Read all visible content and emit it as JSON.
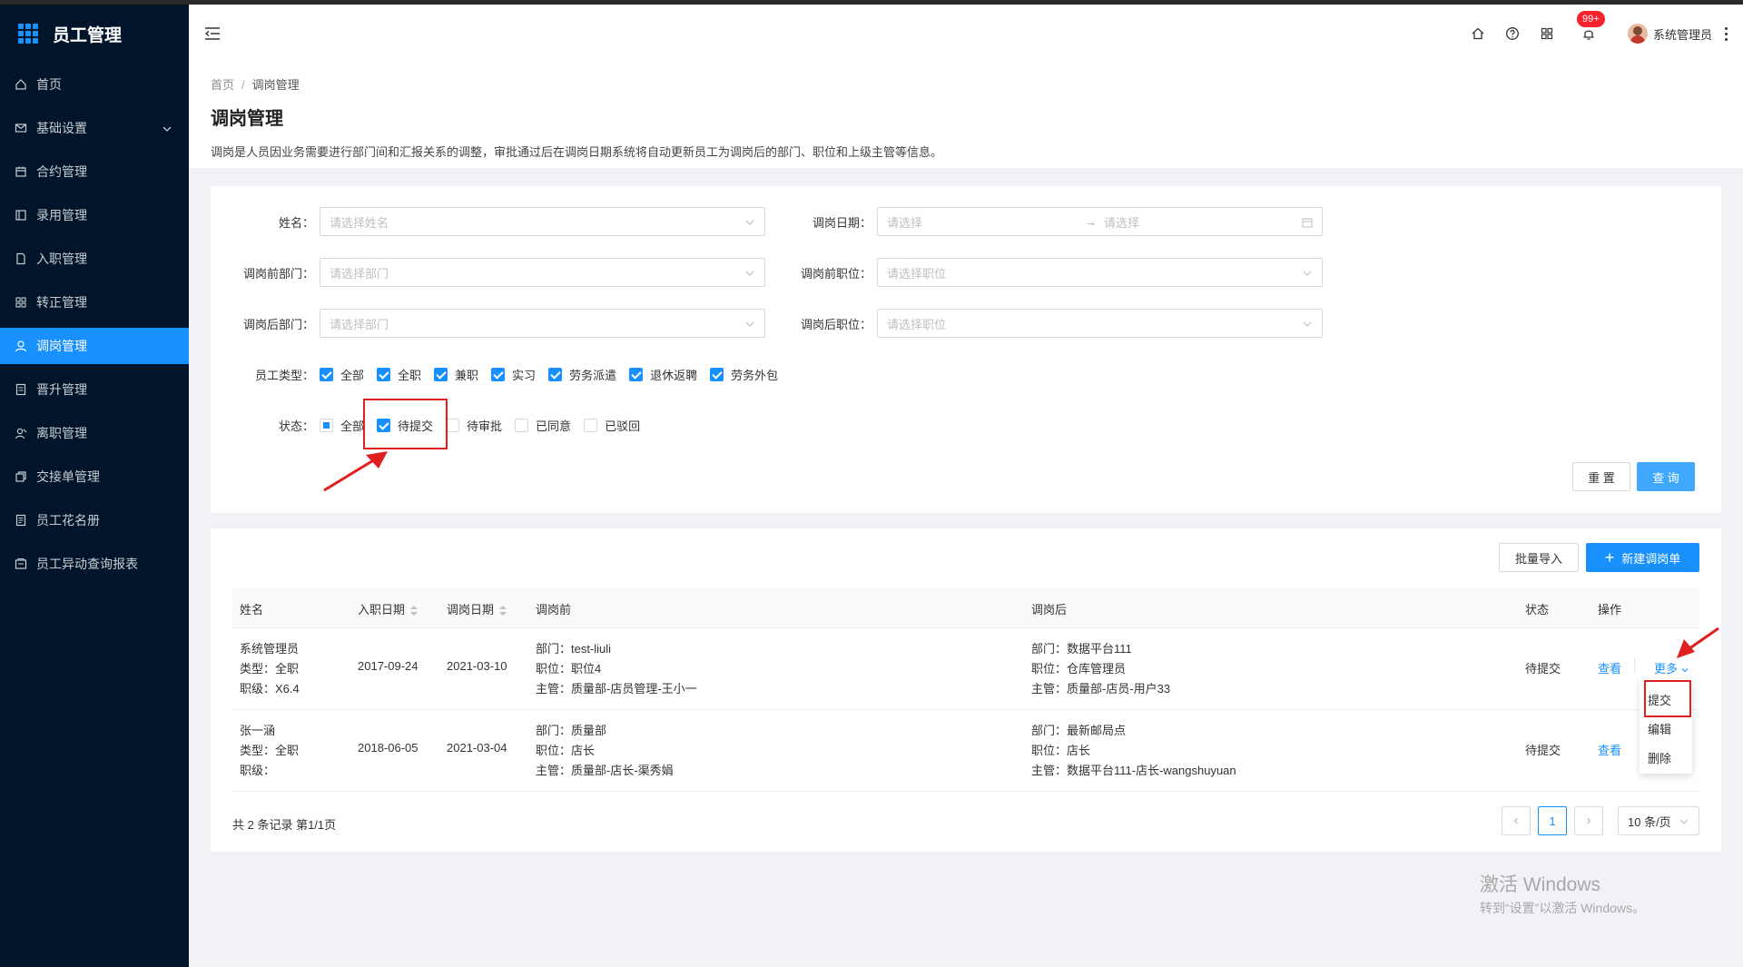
{
  "app": {
    "title": "员工管理"
  },
  "colors": {
    "primary": "#1890ff",
    "sidebar_bg": "#001529",
    "highlight": "#e02020"
  },
  "sidebar": {
    "items": [
      {
        "label": "首页",
        "icon": "home-icon"
      },
      {
        "label": "基础设置",
        "icon": "mail-icon"
      },
      {
        "label": "合约管理",
        "icon": "calendar-icon"
      },
      {
        "label": "录用管理",
        "icon": "book-icon"
      },
      {
        "label": "入职管理",
        "icon": "file-icon"
      },
      {
        "label": "转正管理",
        "icon": "table-icon"
      },
      {
        "label": "调岗管理",
        "icon": "user-icon"
      },
      {
        "label": "晋升管理",
        "icon": "doc-icon"
      },
      {
        "label": "离职管理",
        "icon": "user-leave-icon"
      },
      {
        "label": "交接单管理",
        "icon": "copy-icon"
      },
      {
        "label": "员工花名册",
        "icon": "roster-icon"
      },
      {
        "label": "员工异动查询报表",
        "icon": "report-icon"
      }
    ]
  },
  "header": {
    "badge": "99+",
    "user_name": "系统管理员"
  },
  "page": {
    "breadcrumb_home": "首页",
    "breadcrumb_sep": "/",
    "breadcrumb_current": "调岗管理",
    "title": "调岗管理",
    "description": "调岗是人员因业务需要进行部门间和汇报关系的调整，审批通过后在调岗日期系统将自动更新员工为调岗后的部门、职位和上级主管等信息。"
  },
  "filters": {
    "name_label": "姓名：",
    "name_placeholder": "请选择姓名",
    "date_label": "调岗日期：",
    "date_start_placeholder": "请选择",
    "date_arrow": "→",
    "date_end_placeholder": "请选择",
    "before_dept_label": "调岗前部门：",
    "before_dept_placeholder": "请选择部门",
    "before_pos_label": "调岗前职位：",
    "before_pos_placeholder": "请选择职位",
    "after_dept_label": "调岗后部门：",
    "after_dept_placeholder": "请选择部门",
    "after_pos_label": "调岗后职位：",
    "after_pos_placeholder": "请选择职位",
    "emp_type_label": "员工类型：",
    "emp_types": [
      {
        "label": "全部",
        "checked": true
      },
      {
        "label": "全职",
        "checked": true
      },
      {
        "label": "兼职",
        "checked": true
      },
      {
        "label": "实习",
        "checked": true
      },
      {
        "label": "劳务派遣",
        "checked": true
      },
      {
        "label": "退休返聘",
        "checked": true
      },
      {
        "label": "劳务外包",
        "checked": true
      }
    ],
    "status_label": "状态：",
    "statuses": [
      {
        "label": "全部",
        "state": "indeterminate"
      },
      {
        "label": "待提交",
        "state": "checked"
      },
      {
        "label": "待审批",
        "state": "unchecked"
      },
      {
        "label": "已同意",
        "state": "unchecked"
      },
      {
        "label": "已驳回",
        "state": "unchecked"
      }
    ],
    "reset_label": "重 置",
    "query_label": "查 询"
  },
  "table": {
    "batch_import_label": "批量导入",
    "new_label": "新建调岗单",
    "columns": {
      "name": "姓名",
      "entry_date": "入职日期",
      "transfer_date": "调岗日期",
      "before": "调岗前",
      "after": "调岗后",
      "status": "状态",
      "action": "操作"
    },
    "rows": [
      {
        "name": "系统管理员",
        "type": "类型：全职",
        "level": "职级：X6.4",
        "entry_date": "2017-09-24",
        "transfer_date": "2021-03-10",
        "before_dept": "部门：test-liuli",
        "before_pos": "职位：职位4",
        "before_mgr": "主管：质量部-店员管理-王小一",
        "after_dept": "部门：数据平台111",
        "after_pos": "职位：仓库管理员",
        "after_mgr": "主管：质量部-店员-用户33",
        "status": "待提交",
        "view": "查看",
        "more": "更多"
      },
      {
        "name": "张一涵",
        "type": "类型：全职",
        "level": "职级：",
        "entry_date": "2018-06-05",
        "transfer_date": "2021-03-04",
        "before_dept": "部门：质量部",
        "before_pos": "职位：店长",
        "before_mgr": "主管：质量部-店长-渠秀娟",
        "after_dept": "部门：最新邮局点",
        "after_pos": "职位：店长",
        "after_mgr": "主管：数据平台111-店长-wangshuyuan",
        "status": "待提交",
        "view": "查看"
      }
    ],
    "more_menu": [
      "提交",
      "编辑",
      "删除"
    ],
    "total_text": "共 2 条记录 第1/1页",
    "current_page": "1",
    "page_size": "10 条/页"
  },
  "watermark": {
    "line1": "激活 Windows",
    "line2": "转到“设置”以激活 Windows。"
  }
}
